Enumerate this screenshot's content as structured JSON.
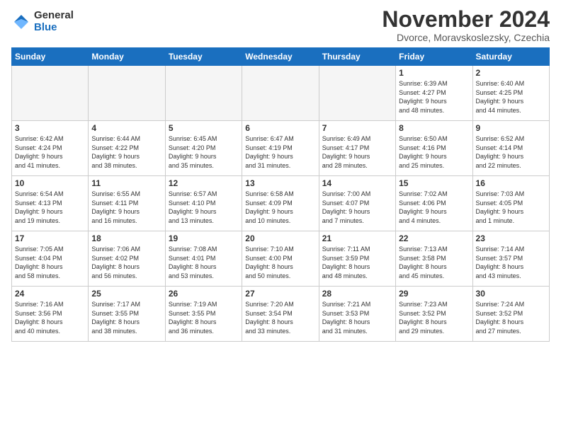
{
  "logo": {
    "line1": "General",
    "line2": "Blue"
  },
  "title": "November 2024",
  "subtitle": "Dvorce, Moravskoslezsky, Czechia",
  "weekdays": [
    "Sunday",
    "Monday",
    "Tuesday",
    "Wednesday",
    "Thursday",
    "Friday",
    "Saturday"
  ],
  "weeks": [
    [
      {
        "day": "",
        "info": ""
      },
      {
        "day": "",
        "info": ""
      },
      {
        "day": "",
        "info": ""
      },
      {
        "day": "",
        "info": ""
      },
      {
        "day": "",
        "info": ""
      },
      {
        "day": "1",
        "info": "Sunrise: 6:39 AM\nSunset: 4:27 PM\nDaylight: 9 hours\nand 48 minutes."
      },
      {
        "day": "2",
        "info": "Sunrise: 6:40 AM\nSunset: 4:25 PM\nDaylight: 9 hours\nand 44 minutes."
      }
    ],
    [
      {
        "day": "3",
        "info": "Sunrise: 6:42 AM\nSunset: 4:24 PM\nDaylight: 9 hours\nand 41 minutes."
      },
      {
        "day": "4",
        "info": "Sunrise: 6:44 AM\nSunset: 4:22 PM\nDaylight: 9 hours\nand 38 minutes."
      },
      {
        "day": "5",
        "info": "Sunrise: 6:45 AM\nSunset: 4:20 PM\nDaylight: 9 hours\nand 35 minutes."
      },
      {
        "day": "6",
        "info": "Sunrise: 6:47 AM\nSunset: 4:19 PM\nDaylight: 9 hours\nand 31 minutes."
      },
      {
        "day": "7",
        "info": "Sunrise: 6:49 AM\nSunset: 4:17 PM\nDaylight: 9 hours\nand 28 minutes."
      },
      {
        "day": "8",
        "info": "Sunrise: 6:50 AM\nSunset: 4:16 PM\nDaylight: 9 hours\nand 25 minutes."
      },
      {
        "day": "9",
        "info": "Sunrise: 6:52 AM\nSunset: 4:14 PM\nDaylight: 9 hours\nand 22 minutes."
      }
    ],
    [
      {
        "day": "10",
        "info": "Sunrise: 6:54 AM\nSunset: 4:13 PM\nDaylight: 9 hours\nand 19 minutes."
      },
      {
        "day": "11",
        "info": "Sunrise: 6:55 AM\nSunset: 4:11 PM\nDaylight: 9 hours\nand 16 minutes."
      },
      {
        "day": "12",
        "info": "Sunrise: 6:57 AM\nSunset: 4:10 PM\nDaylight: 9 hours\nand 13 minutes."
      },
      {
        "day": "13",
        "info": "Sunrise: 6:58 AM\nSunset: 4:09 PM\nDaylight: 9 hours\nand 10 minutes."
      },
      {
        "day": "14",
        "info": "Sunrise: 7:00 AM\nSunset: 4:07 PM\nDaylight: 9 hours\nand 7 minutes."
      },
      {
        "day": "15",
        "info": "Sunrise: 7:02 AM\nSunset: 4:06 PM\nDaylight: 9 hours\nand 4 minutes."
      },
      {
        "day": "16",
        "info": "Sunrise: 7:03 AM\nSunset: 4:05 PM\nDaylight: 9 hours\nand 1 minute."
      }
    ],
    [
      {
        "day": "17",
        "info": "Sunrise: 7:05 AM\nSunset: 4:04 PM\nDaylight: 8 hours\nand 58 minutes."
      },
      {
        "day": "18",
        "info": "Sunrise: 7:06 AM\nSunset: 4:02 PM\nDaylight: 8 hours\nand 56 minutes."
      },
      {
        "day": "19",
        "info": "Sunrise: 7:08 AM\nSunset: 4:01 PM\nDaylight: 8 hours\nand 53 minutes."
      },
      {
        "day": "20",
        "info": "Sunrise: 7:10 AM\nSunset: 4:00 PM\nDaylight: 8 hours\nand 50 minutes."
      },
      {
        "day": "21",
        "info": "Sunrise: 7:11 AM\nSunset: 3:59 PM\nDaylight: 8 hours\nand 48 minutes."
      },
      {
        "day": "22",
        "info": "Sunrise: 7:13 AM\nSunset: 3:58 PM\nDaylight: 8 hours\nand 45 minutes."
      },
      {
        "day": "23",
        "info": "Sunrise: 7:14 AM\nSunset: 3:57 PM\nDaylight: 8 hours\nand 43 minutes."
      }
    ],
    [
      {
        "day": "24",
        "info": "Sunrise: 7:16 AM\nSunset: 3:56 PM\nDaylight: 8 hours\nand 40 minutes."
      },
      {
        "day": "25",
        "info": "Sunrise: 7:17 AM\nSunset: 3:55 PM\nDaylight: 8 hours\nand 38 minutes."
      },
      {
        "day": "26",
        "info": "Sunrise: 7:19 AM\nSunset: 3:55 PM\nDaylight: 8 hours\nand 36 minutes."
      },
      {
        "day": "27",
        "info": "Sunrise: 7:20 AM\nSunset: 3:54 PM\nDaylight: 8 hours\nand 33 minutes."
      },
      {
        "day": "28",
        "info": "Sunrise: 7:21 AM\nSunset: 3:53 PM\nDaylight: 8 hours\nand 31 minutes."
      },
      {
        "day": "29",
        "info": "Sunrise: 7:23 AM\nSunset: 3:52 PM\nDaylight: 8 hours\nand 29 minutes."
      },
      {
        "day": "30",
        "info": "Sunrise: 7:24 AM\nSunset: 3:52 PM\nDaylight: 8 hours\nand 27 minutes."
      }
    ]
  ]
}
